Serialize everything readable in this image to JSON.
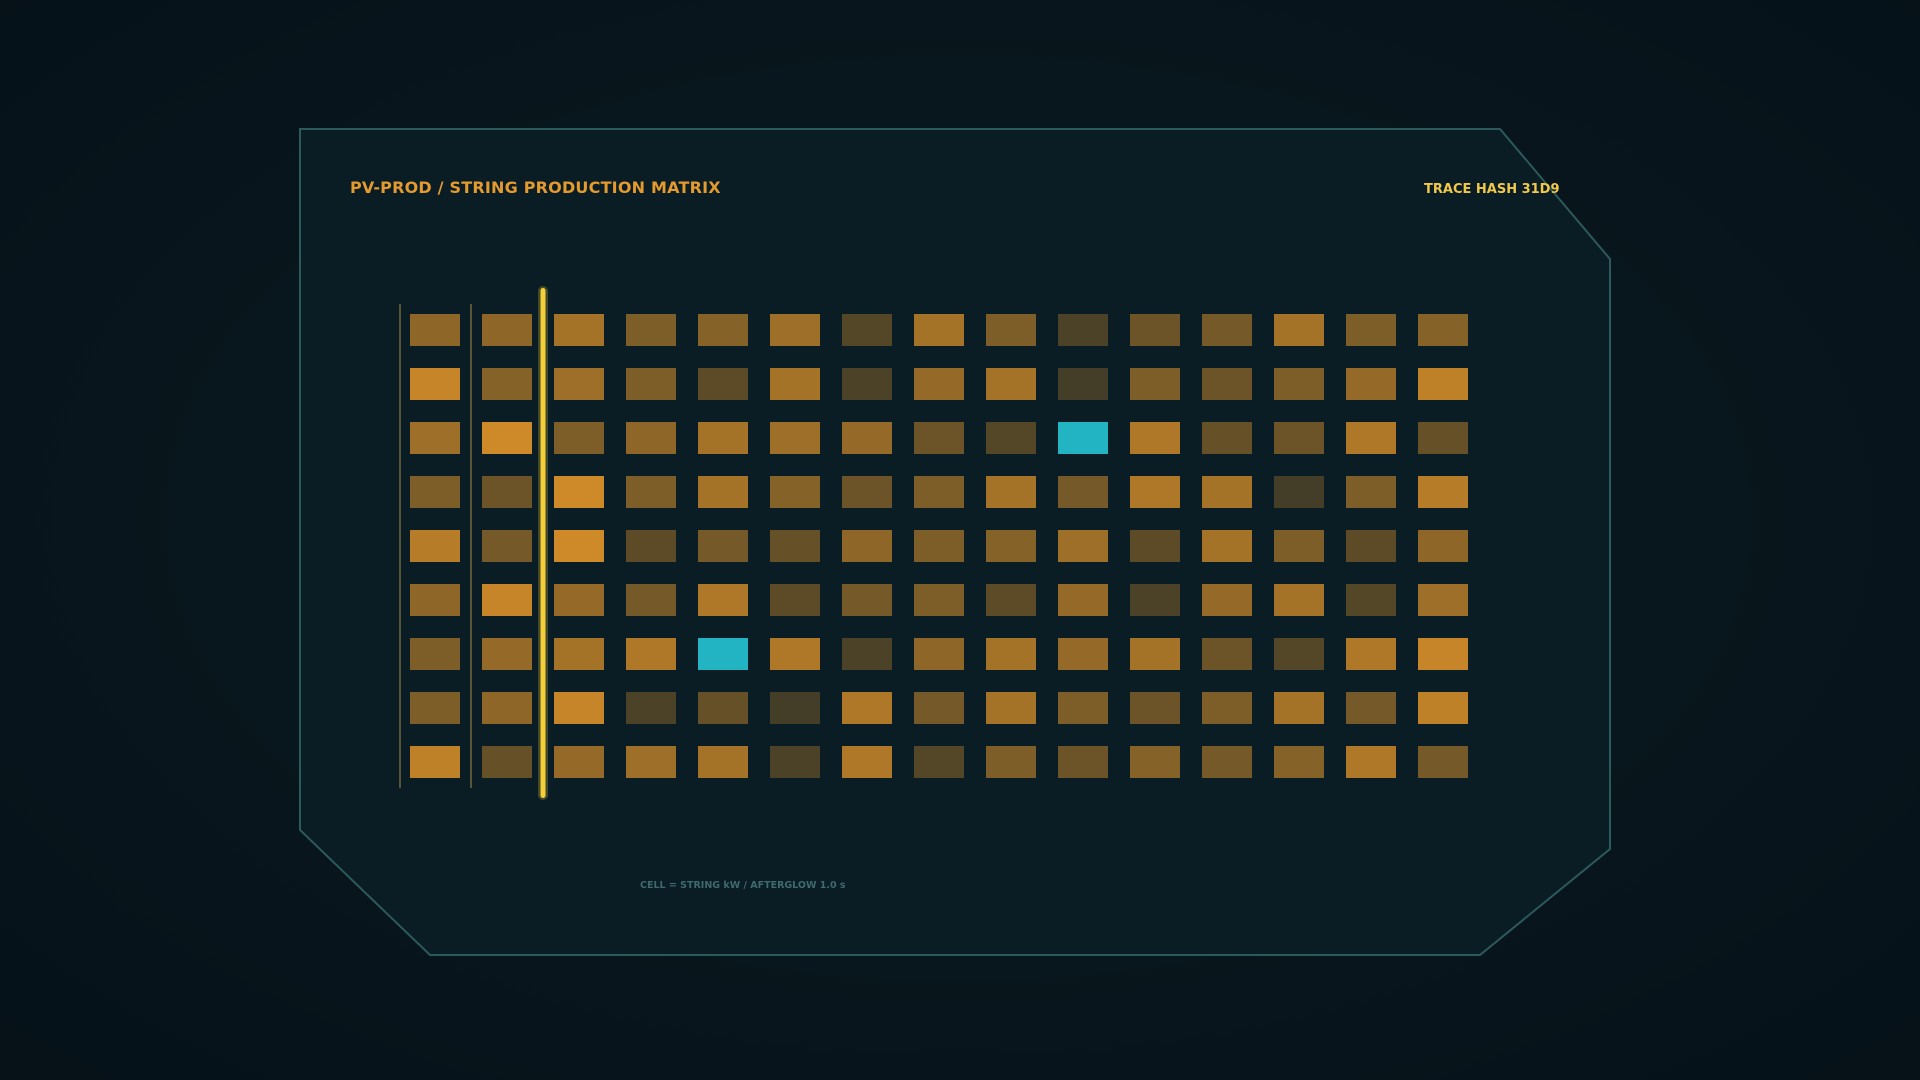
{
  "header": {
    "title": "PV-PROD / STRING PRODUCTION MATRIX",
    "trace_hash": "TRACE HASH 31D9"
  },
  "footer": {
    "legend": "CELL = STRING kW / AFTERGLOW 1.0 s"
  },
  "colors": {
    "background": "#07141b",
    "panel_fill": "#0a1c24",
    "panel_border": "#2c5a5c",
    "accent": "#e39a2f",
    "hash_text": "#f1c94a",
    "cursor": "#f5cf3a",
    "highlight": "#22b4c2",
    "cell_low": "#343528",
    "cell_high": "#d68e28",
    "legend_text": "#3f6a70"
  },
  "matrix": {
    "rows": 9,
    "columns": 15,
    "scan_cursor_after_column": 2,
    "column_divider_after_columns": [
      0,
      1
    ],
    "highlighted_cells": [
      [
        2,
        9
      ],
      [
        6,
        4
      ]
    ],
    "intensity": [
      [
        0.55,
        0.55,
        0.7,
        0.45,
        0.5,
        0.65,
        0.2,
        0.7,
        0.45,
        0.15,
        0.35,
        0.4,
        0.7,
        0.45,
        0.5
      ],
      [
        0.9,
        0.5,
        0.65,
        0.45,
        0.25,
        0.7,
        0.15,
        0.6,
        0.7,
        0.1,
        0.45,
        0.35,
        0.45,
        0.6,
        0.85
      ],
      [
        0.65,
        0.95,
        0.45,
        0.55,
        0.7,
        0.65,
        0.6,
        0.35,
        0.2,
        0.0,
        0.75,
        0.3,
        0.35,
        0.75,
        0.3
      ],
      [
        0.45,
        0.35,
        0.95,
        0.45,
        0.7,
        0.5,
        0.35,
        0.45,
        0.7,
        0.4,
        0.75,
        0.7,
        0.1,
        0.45,
        0.8
      ],
      [
        0.8,
        0.4,
        0.95,
        0.25,
        0.4,
        0.3,
        0.55,
        0.45,
        0.5,
        0.65,
        0.25,
        0.7,
        0.45,
        0.25,
        0.55
      ],
      [
        0.55,
        0.9,
        0.6,
        0.4,
        0.75,
        0.25,
        0.4,
        0.45,
        0.25,
        0.6,
        0.15,
        0.6,
        0.7,
        0.2,
        0.65
      ],
      [
        0.45,
        0.6,
        0.7,
        0.75,
        0.0,
        0.75,
        0.15,
        0.55,
        0.7,
        0.6,
        0.7,
        0.35,
        0.2,
        0.75,
        0.9
      ],
      [
        0.45,
        0.55,
        0.9,
        0.15,
        0.3,
        0.1,
        0.75,
        0.4,
        0.7,
        0.45,
        0.35,
        0.45,
        0.7,
        0.4,
        0.85
      ],
      [
        0.85,
        0.3,
        0.6,
        0.65,
        0.7,
        0.15,
        0.75,
        0.2,
        0.45,
        0.35,
        0.5,
        0.4,
        0.5,
        0.75,
        0.4
      ]
    ]
  }
}
